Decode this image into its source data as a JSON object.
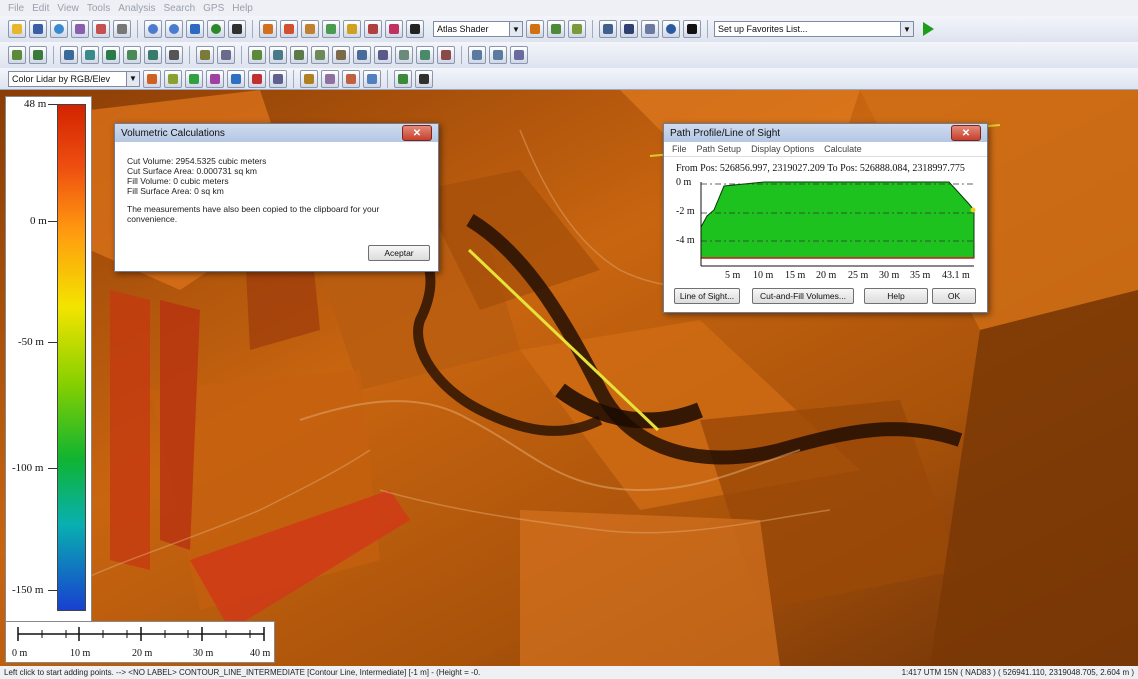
{
  "menu": [
    "File",
    "Edit",
    "View",
    "Tools",
    "Analysis",
    "Search",
    "GPS",
    "Help"
  ],
  "toolbar": {
    "shader_select": "Atlas Shader",
    "favorites_select": "Set up Favorites List...",
    "layer_select": "Color Lidar by RGB/Elev"
  },
  "legend": {
    "labels": [
      "48 m",
      "0 m",
      "-50 m",
      "-100 m",
      "-150 m"
    ]
  },
  "scalebar": {
    "labels": [
      "0 m",
      "10 m",
      "20 m",
      "30 m",
      "40 m"
    ]
  },
  "volumetric_dialog": {
    "title": "Volumetric Calculations",
    "lines": [
      "Cut Volume: 2954.5325 cubic meters",
      "Cut Surface Area: 0.000731 sq km",
      "Fill Volume: 0 cubic meters",
      "Fill Surface Area: 0 sq km"
    ],
    "note": "The measurements have also been copied to the clipboard for your convenience.",
    "ok_label": "Aceptar"
  },
  "profile_dialog": {
    "title": "Path Profile/Line of Sight",
    "menus": [
      "File",
      "Path Setup",
      "Display Options",
      "Calculate"
    ],
    "position_text": "From Pos: 526856.997, 2319027.209 To Pos: 526888.084, 2318997.775",
    "y_labels": [
      "0 m",
      "-2 m",
      "-4 m"
    ],
    "x_labels": [
      "5 m",
      "10 m",
      "15 m",
      "20 m",
      "25 m",
      "30 m",
      "35 m",
      "43.1 m"
    ],
    "buttons": [
      "Line of Sight...",
      "Cut-and-Fill Volumes...",
      "Help",
      "OK"
    ]
  },
  "status": {
    "left": "Left click to start adding points. --> <NO LABEL> CONTOUR_LINE_INTERMEDIATE [Contour Line, Intermediate] [-1 m] - (Height = -0.",
    "right": "1:417  UTM 15N ( NAD83 ) ( 526941.110, 2319048.705, 2.604 m )"
  }
}
